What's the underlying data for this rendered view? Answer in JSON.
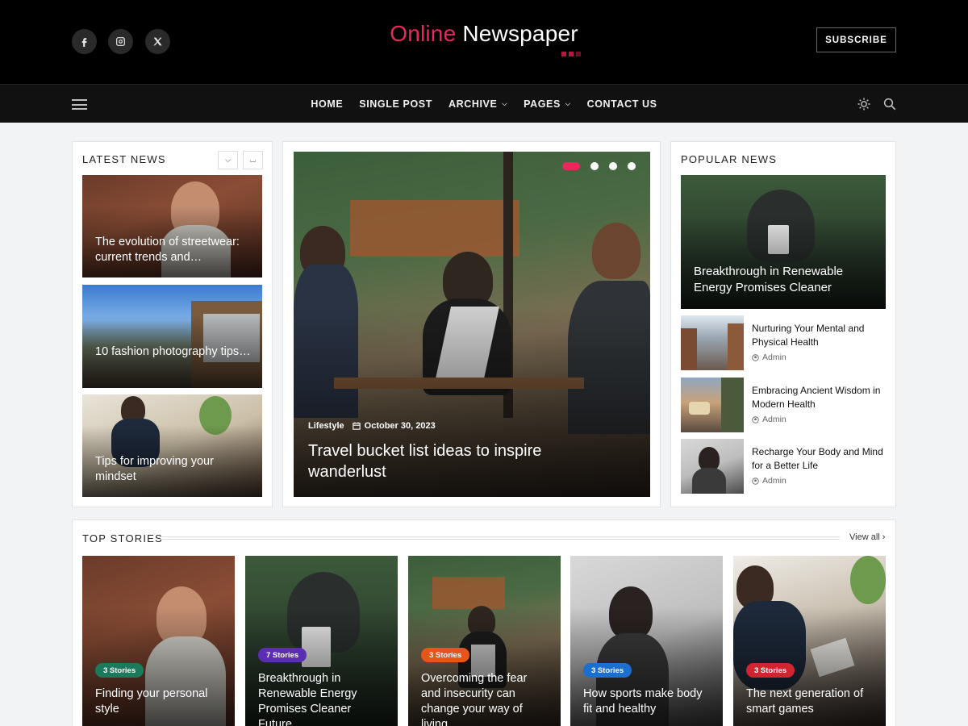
{
  "header": {
    "logo_part1": "Online",
    "logo_part2": "Newspaper",
    "subscribe": "SUBSCRIBE",
    "social": [
      "facebook-icon",
      "instagram-icon",
      "x-icon"
    ]
  },
  "nav": {
    "links": [
      {
        "label": "HOME",
        "dropdown": false
      },
      {
        "label": "SINGLE POST",
        "dropdown": false
      },
      {
        "label": "ARCHIVE",
        "dropdown": true
      },
      {
        "label": "PAGES",
        "dropdown": true
      },
      {
        "label": "CONTACT US",
        "dropdown": false
      }
    ],
    "icons": [
      "hamburger-icon",
      "theme-toggle-icon",
      "search-icon"
    ]
  },
  "latest": {
    "title": "LATEST NEWS",
    "items": [
      {
        "caption": "The evolution of streetwear: current trends and…"
      },
      {
        "caption": "10 fashion photography tips…"
      },
      {
        "caption": "Tips for improving your mindset"
      }
    ]
  },
  "featured": {
    "category": "Lifestyle",
    "date": "October 30, 2023",
    "title": "Travel bucket list ideas to inspire wanderlust",
    "slides": 4,
    "active_slide": 1
  },
  "popular": {
    "title": "POPULAR NEWS",
    "hero": "Breakthrough in Renewable Energy Promises Cleaner",
    "items": [
      {
        "title": "Nurturing Your Mental and Physical Health",
        "author": "Admin"
      },
      {
        "title": "Embracing Ancient Wisdom in Modern Health",
        "author": "Admin"
      },
      {
        "title": "Recharge Your Body and Mind for a Better Life",
        "author": "Admin"
      }
    ]
  },
  "top_stories": {
    "title": "TOP STORIES",
    "view_all": "View all",
    "cards": [
      {
        "badge": "3 Stories",
        "badge_color": "#1c7a5c",
        "title": "Finding your personal style"
      },
      {
        "badge": "7 Stories",
        "badge_color": "#5b2db5",
        "title": "Breakthrough in Renewable Energy Promises Cleaner Future"
      },
      {
        "badge": "3 Stories",
        "badge_color": "#e8541a",
        "title": "Overcoming the fear and insecurity can change your way of living"
      },
      {
        "badge": "3 Stories",
        "badge_color": "#1a6fd0",
        "title": "How sports make body fit and healthy"
      },
      {
        "badge": "3 Stories",
        "badge_color": "#d0242e",
        "title": "The next generation of smart games"
      }
    ]
  },
  "colors": {
    "accent": "#e8275a",
    "header_bg": "#000000",
    "nav_bg": "#111111"
  }
}
